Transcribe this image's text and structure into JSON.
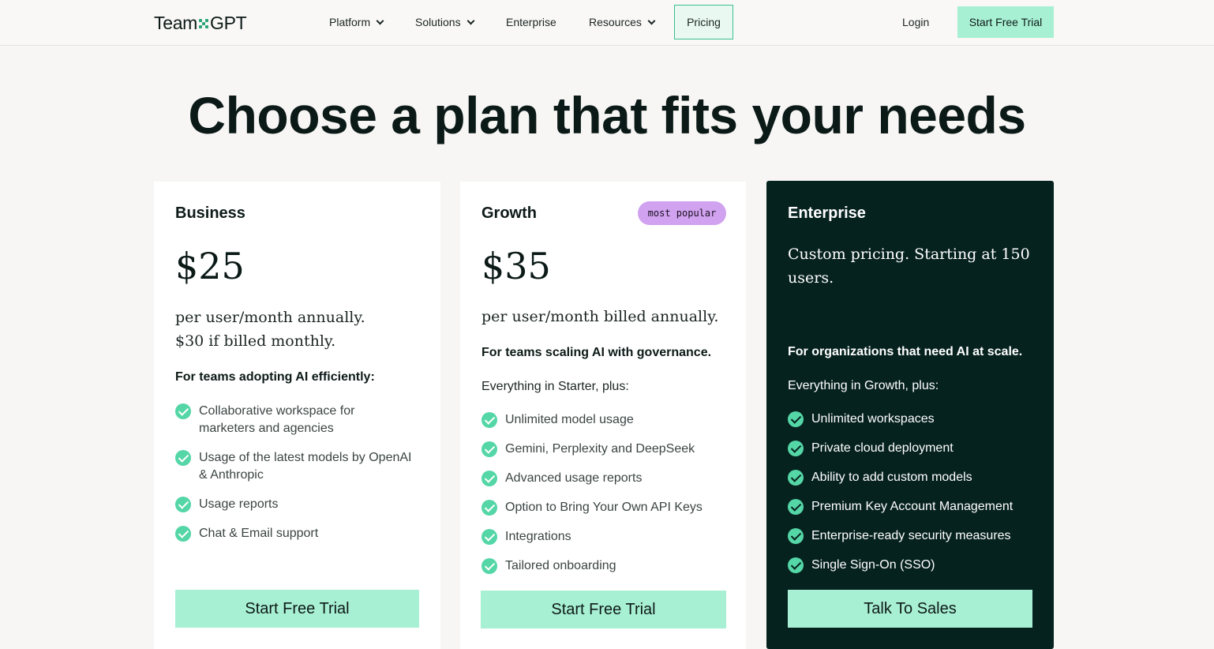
{
  "nav": {
    "logo_left": "Team",
    "logo_right": "GPT",
    "items": [
      {
        "label": "Platform"
      },
      {
        "label": "Solutions"
      },
      {
        "label": "Enterprise"
      },
      {
        "label": "Resources"
      }
    ],
    "pricing_label": "Pricing",
    "login_label": "Login",
    "cta_label": "Start Free Trial"
  },
  "headline": "Choose a plan that fits your needs",
  "plans": [
    {
      "name": "Business",
      "price": "$25",
      "price_note_1": "per user/month annually.",
      "price_note_2": "$30 if billed monthly.",
      "tagline": "For teams adopting AI efficiently:",
      "features": [
        "Collaborative workspace for marketers and agencies",
        "Usage of the latest models by OpenAI & Anthropic",
        "Usage reports",
        "Chat & Email support"
      ],
      "cta": "Start Free Trial"
    },
    {
      "name": "Growth",
      "badge": "most popular",
      "price": "$35",
      "price_note_1": "per user/month billed annually.",
      "tagline": "For teams scaling AI with governance.",
      "intro": "Everything in Starter, plus:",
      "features": [
        "Unlimited model usage",
        "Gemini, Perplexity and DeepSeek",
        "Advanced usage reports",
        "Option to Bring Your Own API Keys",
        "Integrations",
        "Tailored onboarding"
      ],
      "cta": "Start Free Trial"
    },
    {
      "name": "Enterprise",
      "price_note_1": "Custom pricing. Starting at 150",
      "price_note_2": "users.",
      "tagline": "For organizations that need AI at scale.",
      "intro": "Everything in Growth, plus:",
      "features": [
        "Unlimited workspaces",
        "Private cloud deployment",
        "Ability to add custom models",
        "Premium Key Account Management",
        "Enterprise-ready security measures",
        "Single Sign-On (SSO)"
      ],
      "cta": "Talk To Sales"
    }
  ],
  "colors": {
    "accent_mint": "#a8f0d3",
    "check_green": "#54d6a6",
    "dark_card": "#06221f",
    "badge_purple": "#d0a2ef"
  }
}
